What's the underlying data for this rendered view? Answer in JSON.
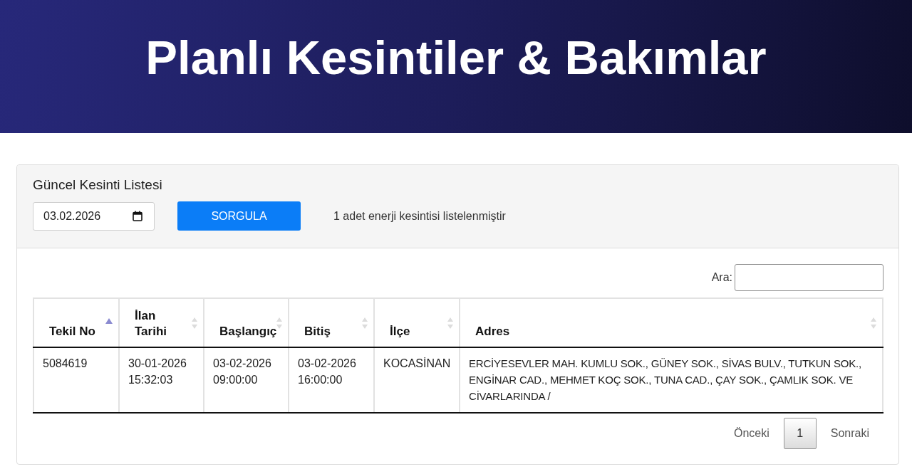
{
  "header": {
    "title": "Planlı Kesintiler & Bakımlar"
  },
  "panel": {
    "title": "Güncel Kesinti Listesi",
    "date_field": {
      "value": "03.02.2026"
    },
    "query_button": "SORGULA",
    "result_text": "1 adet enerji kesintisi listelenmiştir"
  },
  "search": {
    "label": "Ara:"
  },
  "table": {
    "columns": [
      {
        "label": "Tekil No",
        "sorted": true
      },
      {
        "label": "İlan Tarihi",
        "sorted": false
      },
      {
        "label": "Başlangıç",
        "sorted": false
      },
      {
        "label": "Bitiş",
        "sorted": false
      },
      {
        "label": "İlçe",
        "sorted": false
      },
      {
        "label": "Adres",
        "sorted": false
      }
    ],
    "rows": [
      {
        "cells": [
          "5084619",
          "30-01-2026 15:32:03",
          "03-02-2026 09:00:00",
          "03-02-2026 16:00:00",
          "KOCASİNAN",
          "ERCİYESEVLER MAH. KUMLU SOK., GÜNEY SOK., SİVAS BULV., TUTKUN SOK., ENGİNAR CAD., MEHMET KOÇ SOK., TUNA CAD., ÇAY SOK., ÇAMLIK SOK. VE CİVARLARINDA /"
        ]
      }
    ]
  },
  "pagination": {
    "previous": "Önceki",
    "pages": [
      {
        "label": "1",
        "selected": true
      }
    ],
    "next": "Sonraki"
  }
}
